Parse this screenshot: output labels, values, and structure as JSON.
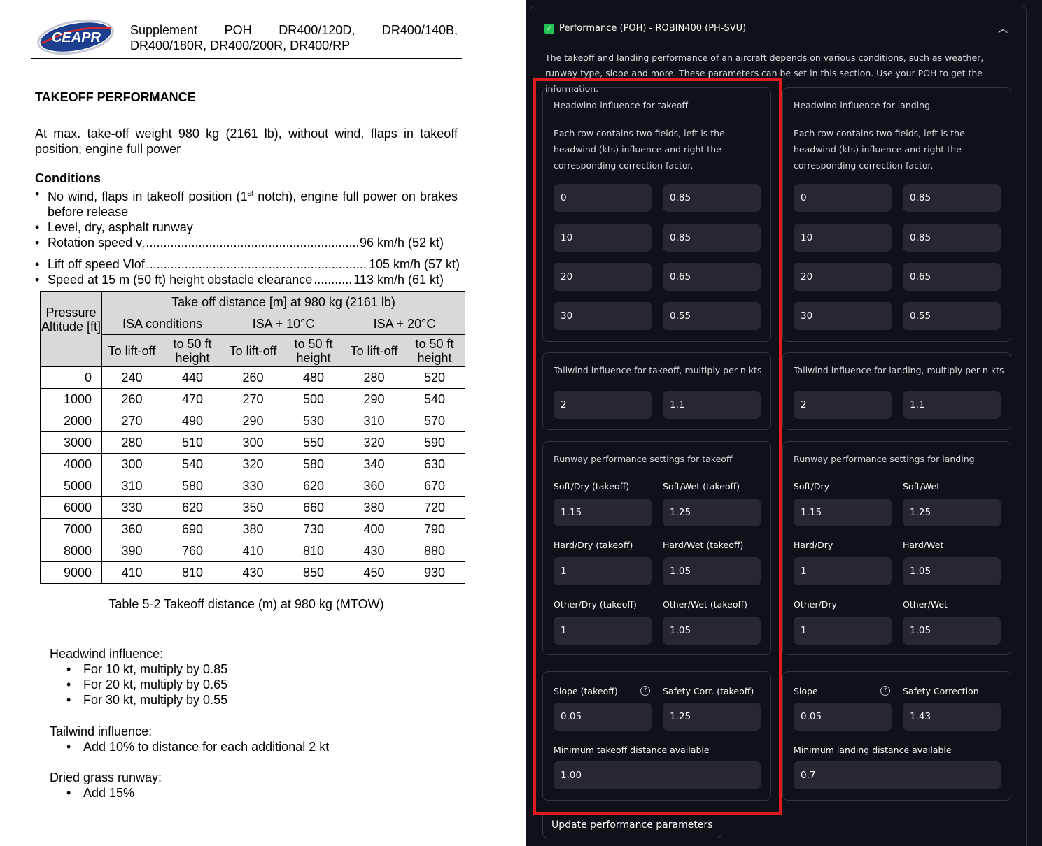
{
  "doc": {
    "logo_text": "CEAPR",
    "header_line1": [
      "Supplement",
      "POH",
      "DR400/120D,",
      "DR400/140B,"
    ],
    "header_line2": "DR400/180R, DR400/200R, DR400/RP",
    "title": "TAKEOFF PERFORMANCE",
    "intro": "At max. take-off weight 980 kg (2161 lb), without wind, flaps in takeoff position, engine full power",
    "conditions_title": "Conditions",
    "cond1_a": "No wind, flaps in takeoff position (1",
    "cond1_sup": "st",
    "cond1_b": " notch), engine full power on brakes before release",
    "cond2": "Level, dry, asphalt runway",
    "cond3_label": "Rotation speed v",
    "cond3_sub": "r",
    "cond3_value": "96 km/h (52 kt)",
    "cond4_label": "Lift off speed Vlof",
    "cond4_value": "105 km/h (57 kt)",
    "cond5_label": "Speed at 15 m (50 ft) height obstacle clearance",
    "cond5_value": "113 km/h (61 kt)",
    "table": {
      "corner": "Pressure Altitude [ft]",
      "group_title": "Take off distance [m] at 980 kg (2161 lb)",
      "conditions": [
        "ISA conditions",
        "ISA + 10°C",
        "ISA + 20°C"
      ],
      "sub_liftoff": "To lift-off",
      "sub_50ft": "to 50 ft height",
      "rows": [
        [
          "0",
          "240",
          "440",
          "260",
          "480",
          "280",
          "520"
        ],
        [
          "1000",
          "260",
          "470",
          "270",
          "500",
          "290",
          "540"
        ],
        [
          "2000",
          "270",
          "490",
          "290",
          "530",
          "310",
          "570"
        ],
        [
          "3000",
          "280",
          "510",
          "300",
          "550",
          "320",
          "590"
        ],
        [
          "4000",
          "300",
          "540",
          "320",
          "580",
          "340",
          "630"
        ],
        [
          "5000",
          "310",
          "580",
          "330",
          "620",
          "360",
          "670"
        ],
        [
          "6000",
          "330",
          "620",
          "350",
          "660",
          "380",
          "720"
        ],
        [
          "7000",
          "360",
          "690",
          "380",
          "730",
          "400",
          "790"
        ],
        [
          "8000",
          "390",
          "760",
          "410",
          "810",
          "430",
          "880"
        ],
        [
          "9000",
          "410",
          "810",
          "430",
          "850",
          "450",
          "930"
        ]
      ]
    },
    "caption": "Table 5-2 Takeoff distance (m) at 980 kg (MTOW)",
    "headwind_title": "Headwind influence:",
    "headwind_items": [
      "For 10 kt, multiply by 0.85",
      "For 20 kt, multiply by 0.65",
      "For 30 kt, multiply by 0.55"
    ],
    "tailwind_title": "Tailwind influence:",
    "tailwind_items": [
      "Add 10% to distance for each additional 2 kt"
    ],
    "grass_title": "Dried grass runway:",
    "grass_items": [
      "Add 15%"
    ]
  },
  "app": {
    "expander_title": "Performance (POH) - ROBIN400 (PH-SVU)",
    "check_mark": "✓",
    "chevron": "︿",
    "description": "The takeoff and landing performance of an aircraft depends on various conditions, such as weather, runway type, slope and more. These parameters can be set in this section. Use your POH to get the information.",
    "takeoff": {
      "headwind_title": "Headwind influence for takeoff",
      "headwind_desc": "Each row contains two fields, left is the headwind (kts) influence and right the corresponding correction factor.",
      "headwind_rows": [
        [
          "0",
          "0.85"
        ],
        [
          "10",
          "0.85"
        ],
        [
          "20",
          "0.65"
        ],
        [
          "30",
          "0.55"
        ]
      ],
      "tailwind_title": "Tailwind influence for takeoff, multiply per n kts",
      "tailwind_values": [
        "2",
        "1.1"
      ],
      "runway_title": "Runway performance settings for takeoff",
      "soft_dry_label": "Soft/Dry (takeoff)",
      "soft_dry": "1.15",
      "soft_wet_label": "Soft/Wet (takeoff)",
      "soft_wet": "1.25",
      "hard_dry_label": "Hard/Dry (takeoff)",
      "hard_dry": "1",
      "hard_wet_label": "Hard/Wet (takeoff)",
      "hard_wet": "1.05",
      "other_dry_label": "Other/Dry (takeoff)",
      "other_dry": "1",
      "other_wet_label": "Other/Wet (takeoff)",
      "other_wet": "1.05",
      "slope_label": "Slope (takeoff)",
      "slope": "0.05",
      "safety_label": "Safety Corr. (takeoff)",
      "safety": "1.25",
      "min_dist_label": "Minimum takeoff distance available",
      "min_dist": "1.00"
    },
    "landing": {
      "headwind_title": "Headwind influence for landing",
      "headwind_desc": "Each row contains two fields, left is the headwind (kts) influence and right the corresponding correction factor.",
      "headwind_rows": [
        [
          "0",
          "0.85"
        ],
        [
          "10",
          "0.85"
        ],
        [
          "20",
          "0.65"
        ],
        [
          "30",
          "0.55"
        ]
      ],
      "tailwind_title": "Tailwind influence for landing, multiply per n kts",
      "tailwind_values": [
        "2",
        "1.1"
      ],
      "runway_title": "Runway performance settings for landing",
      "soft_dry_label": "Soft/Dry",
      "soft_dry": "1.15",
      "soft_wet_label": "Soft/Wet",
      "soft_wet": "1.25",
      "hard_dry_label": "Hard/Dry",
      "hard_dry": "1",
      "hard_wet_label": "Hard/Wet",
      "hard_wet": "1.05",
      "other_dry_label": "Other/Dry",
      "other_dry": "1",
      "other_wet_label": "Other/Wet",
      "other_wet": "1.05",
      "slope_label": "Slope",
      "slope": "0.05",
      "safety_label": "Safety Correction",
      "safety": "1.43",
      "min_dist_label": "Minimum landing distance available",
      "min_dist": "0.7"
    },
    "help_glyph": "?",
    "update_button": "Update performance parameters",
    "highlight_color": "#e21b23",
    "accent_color": "#21c354"
  }
}
